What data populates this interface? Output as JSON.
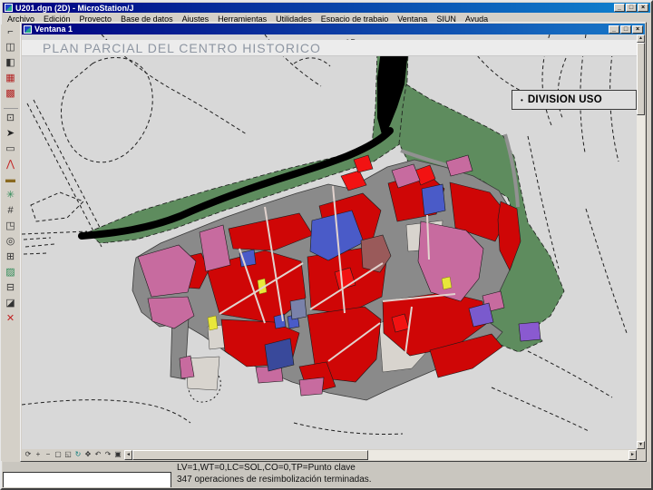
{
  "window": {
    "title": "U201.dgn (2D) - MicroStation/J",
    "controls": {
      "minimize": "_",
      "restore": "□",
      "close": "×"
    }
  },
  "menubar": {
    "items": [
      {
        "name": "menu-archivo",
        "label": "Archivo"
      },
      {
        "name": "menu-edicion",
        "label": "Edición"
      },
      {
        "name": "menu-proyecto",
        "label": "Proyecto"
      },
      {
        "name": "menu-base-de-datos",
        "label": "Base de datos"
      },
      {
        "name": "menu-ajustes",
        "label": "Ajustes"
      },
      {
        "name": "menu-herramientas",
        "label": "Herramientas"
      },
      {
        "name": "menu-utilidades",
        "label": "Utilidades"
      },
      {
        "name": "menu-espacio-de-trabajo",
        "label": "Espacio de trabajo"
      },
      {
        "name": "menu-ventana",
        "label": "Ventana"
      },
      {
        "name": "menu-siun",
        "label": "SIUN"
      },
      {
        "name": "menu-ayuda",
        "label": "Ayuda"
      }
    ]
  },
  "toolframe": {
    "tools": [
      {
        "name": "main-tool-linear-icon",
        "glyph": "⌐",
        "color": "#333333"
      },
      {
        "name": "main-tool-copy-icon",
        "glyph": "◫",
        "color": "#333333"
      },
      {
        "name": "main-tool-mirror-icon",
        "glyph": "◧",
        "color": "#333333"
      },
      {
        "name": "main-tool-cells-icon",
        "glyph": "▦",
        "color": "#B22222"
      },
      {
        "name": "main-tool-patterns-icon",
        "glyph": "▩",
        "color": "#B22222"
      },
      {
        "name": "main-tool-change-attributes-icon",
        "glyph": "⊡",
        "color": "#333333"
      },
      {
        "name": "main-tool-element-selection-icon",
        "glyph": "➤",
        "color": "#222222"
      },
      {
        "name": "main-tool-fence-icon",
        "glyph": "▭",
        "color": "#333333"
      },
      {
        "name": "main-tool-points-icon",
        "glyph": "⋀",
        "color": "#C22222"
      },
      {
        "name": "main-tool-measure-icon",
        "glyph": "▬",
        "color": "#8A6A20"
      },
      {
        "name": "main-tool-terrain-icon",
        "glyph": "✳",
        "color": "#2E8B57"
      },
      {
        "name": "main-tool-tags-icon",
        "glyph": "#",
        "color": "#333333"
      },
      {
        "name": "main-tool-modify-icon",
        "glyph": "◳",
        "color": "#333333"
      },
      {
        "name": "main-tool-circles-icon",
        "glyph": "◎",
        "color": "#333333"
      },
      {
        "name": "main-tool-grid-icon",
        "glyph": "⊞",
        "color": "#333333"
      },
      {
        "name": "main-tool-hatch-icon",
        "glyph": "▨",
        "color": "#2E8B57"
      },
      {
        "name": "main-tool-manipulate-icon",
        "glyph": "⊟",
        "color": "#333333"
      },
      {
        "name": "main-tool-drop-icon",
        "glyph": "◪",
        "color": "#333333"
      },
      {
        "name": "main-tool-delete-icon",
        "glyph": "✕",
        "color": "#C22222"
      }
    ]
  },
  "view_window": {
    "title": "Ventana 1",
    "controls": {
      "minimize": "_",
      "restore": "□",
      "close": "×"
    }
  },
  "map": {
    "title": "PLAN PARCIAL DEL CENTRO HISTORICO",
    "legend": {
      "bullet": "•",
      "label": "DIVISION USO"
    }
  },
  "view_controls": {
    "tools": [
      {
        "name": "view-update-icon",
        "glyph": "⟳",
        "color": "#333333"
      },
      {
        "name": "view-zoom-in-icon",
        "glyph": "+",
        "color": "#333333"
      },
      {
        "name": "view-zoom-out-icon",
        "glyph": "−",
        "color": "#333333"
      },
      {
        "name": "view-window-area-icon",
        "glyph": "▢",
        "color": "#333333"
      },
      {
        "name": "view-fit-icon",
        "glyph": "◱",
        "color": "#333333"
      },
      {
        "name": "view-rotate-icon",
        "glyph": "↻",
        "color": "#0E7D7D"
      },
      {
        "name": "view-pan-icon",
        "glyph": "✥",
        "color": "#333333"
      },
      {
        "name": "view-previous-icon",
        "glyph": "↶",
        "color": "#333333"
      },
      {
        "name": "view-next-icon",
        "glyph": "↷",
        "color": "#333333"
      },
      {
        "name": "view-copy-icon",
        "glyph": "▣",
        "color": "#333333"
      }
    ]
  },
  "scrollbars": {
    "up": "▲",
    "down": "▼",
    "left": "◄",
    "right": "►"
  },
  "statusbar": {
    "settings": "LV=1,WT=0,LC=SOL,CO=0,TP=Punto clave",
    "message": "347 operaciones de resimbolización terminadas."
  },
  "palette": {
    "titlebar_blue": "#000080",
    "titlebar_blue_fade": "#1084D0",
    "window_gray": "#D4D0C8",
    "map_background": "#D8D8D8",
    "map_title_band": "#ECECEC",
    "map_title_text": "#8E96A2",
    "green_zone": "#5E8C5E",
    "river_black": "#000000",
    "street_gray": "#8A8A8A",
    "building_red": "#CF0606",
    "building_red_bright": "#F21212",
    "building_pink": "#C76B9F",
    "building_blue": "#4A5BC8",
    "building_navy": "#39499B",
    "building_violet": "#7A5ACD",
    "building_brown": "#9A5A5A",
    "building_yellow": "#E8E73A",
    "empty_block": "#D8D4CE"
  }
}
